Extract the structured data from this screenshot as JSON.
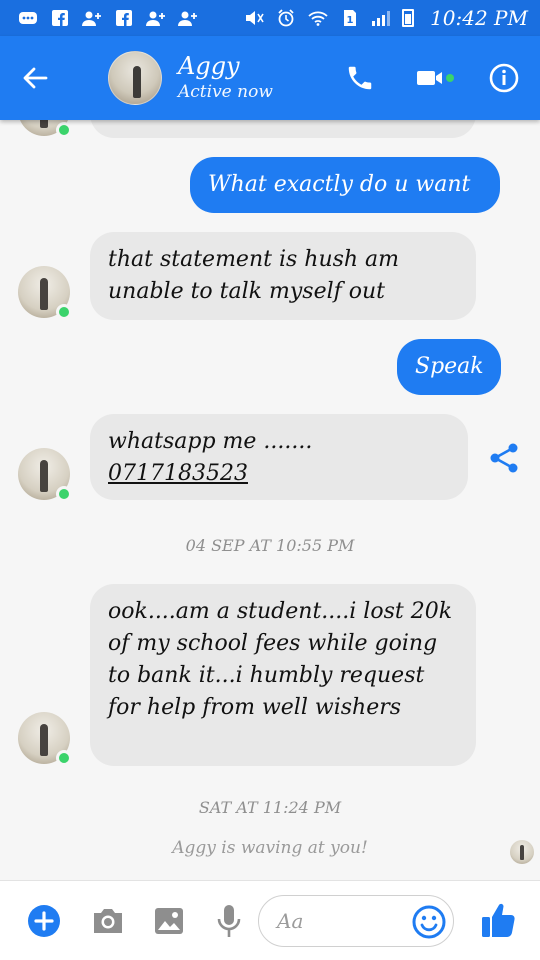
{
  "status_bar": {
    "time": "10:42 PM",
    "icons": [
      "messenger-notification-icon",
      "facebook-icon",
      "add-friend-icon",
      "facebook-icon",
      "add-friend-icon",
      "add-friend-icon",
      "mute-icon",
      "alarm-icon",
      "wifi-icon",
      "sim-icon",
      "signal-icon",
      "battery-icon"
    ]
  },
  "header": {
    "contact_name": "Aggy",
    "status": "Active now",
    "accent": "#1f7cf2"
  },
  "messages": [
    {
      "side": "in",
      "text": "that statement is hush am unable to talk myself out"
    },
    {
      "side": "out",
      "text": "What exactly do u want"
    },
    {
      "side": "out",
      "text": "Speak"
    },
    {
      "side": "in",
      "text_line1": "whatsapp me .......",
      "text_phone": "0717183523"
    },
    {
      "side": "in",
      "text": "ook....am a student....i lost 20k of my school fees while going to bank it...i humbly request for help from well wishers"
    }
  ],
  "timestamps": {
    "first": "04 SEP AT 10:55 PM",
    "second": "SAT AT 11:24 PM"
  },
  "wave_text": "Aggy is waving at you!",
  "composer": {
    "placeholder": "Aa"
  },
  "colors": {
    "messenger_blue": "#1f7cf2",
    "online_green": "#3bd36b",
    "incoming_bubble": "#e8e8e8"
  }
}
